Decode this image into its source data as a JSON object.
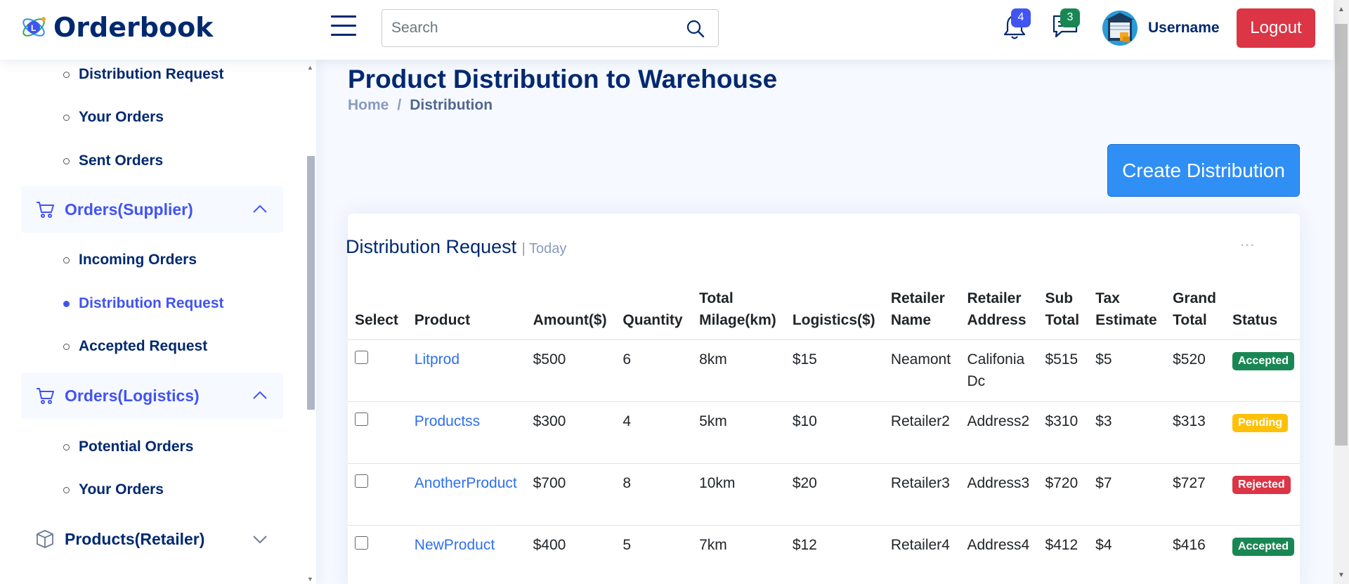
{
  "header": {
    "app_title": "Orderbook",
    "search_placeholder": "Search",
    "notifications_count": "4",
    "messages_count": "3",
    "username": "Username",
    "logout_label": "Logout"
  },
  "sidebar": {
    "items_top": [
      "Distribution Request",
      "Your Orders",
      "Sent Orders"
    ],
    "group_supplier": "Orders(Supplier)",
    "supplier_items": [
      "Incoming Orders",
      "Distribution Request",
      "Accepted Request"
    ],
    "group_logistics": "Orders(Logistics)",
    "logistics_items": [
      "Potential Orders",
      "Your Orders"
    ],
    "group_products_retailer": "Products(Retailer)"
  },
  "page": {
    "title": "Product Distribution to Warehouse",
    "breadcrumb_home": "Home",
    "breadcrumb_separator": "/",
    "breadcrumb_current": "Distribution",
    "create_button": "Create Distribution"
  },
  "card": {
    "title": "Distribution Request",
    "subtitle": "| Today",
    "more": "..."
  },
  "table": {
    "headers": [
      "Select",
      "Product",
      "Amount($)",
      "Quantity",
      "Total Milage(km)",
      "Logistics($)",
      "Retailer Name",
      "Retailer Address",
      "Sub Total",
      "Tax Estimate",
      "Grand Total",
      "Status"
    ],
    "rows": [
      {
        "product": "Litprod",
        "amount": "$500",
        "quantity": "6",
        "milage": "8km",
        "logistics": "$15",
        "retailer": "Neamont",
        "address": "Califonia Dc",
        "subtotal": "$515",
        "tax": "$5",
        "grand": "$520",
        "status": "Accepted",
        "status_color": "#198754"
      },
      {
        "product": "Productss",
        "amount": "$300",
        "quantity": "4",
        "milage": "5km",
        "logistics": "$10",
        "retailer": "Retailer2",
        "address": "Address2",
        "subtotal": "$310",
        "tax": "$3",
        "grand": "$313",
        "status": "Pending",
        "status_color": "#ffc107"
      },
      {
        "product": "AnotherProduct",
        "amount": "$700",
        "quantity": "8",
        "milage": "10km",
        "logistics": "$20",
        "retailer": "Retailer3",
        "address": "Address3",
        "subtotal": "$720",
        "tax": "$7",
        "grand": "$727",
        "status": "Rejected",
        "status_color": "#dc3545"
      },
      {
        "product": "NewProduct",
        "amount": "$400",
        "quantity": "5",
        "milage": "7km",
        "logistics": "$12",
        "retailer": "Retailer4",
        "address": "Address4",
        "subtotal": "$412",
        "tax": "$4",
        "grand": "$416",
        "status": "Accepted",
        "status_color": "#198754"
      }
    ]
  },
  "colors": {
    "brand": "#012970",
    "accent": "#4154f1",
    "danger": "#dc3545",
    "create_button": "#2f8ff5"
  }
}
